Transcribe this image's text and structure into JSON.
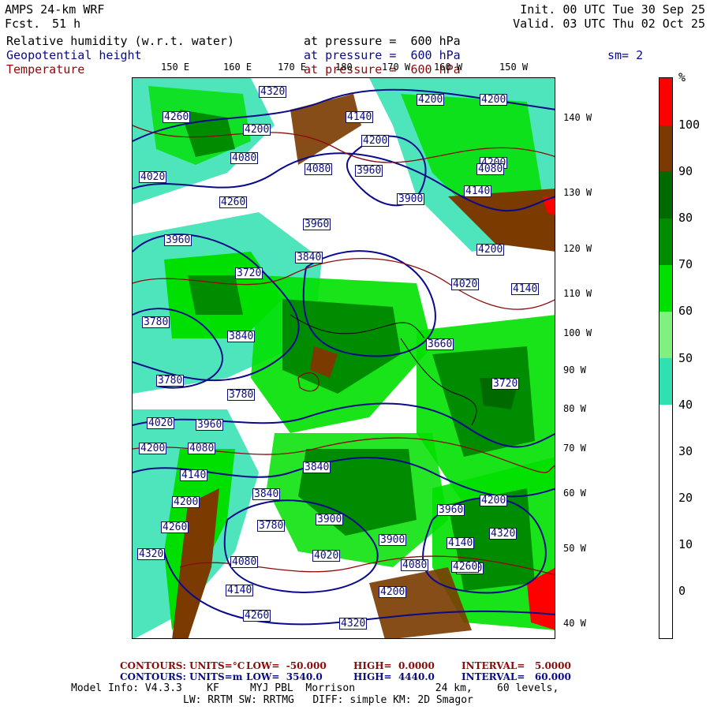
{
  "header": {
    "model": "AMPS 24-km WRF",
    "fcst_label": "Fcst.",
    "fcst_hours": "51 h",
    "init": "Init. 00 UTC Tue 30 Sep 25",
    "valid": "Valid. 03 UTC Thu 02 Oct 25"
  },
  "fields": [
    {
      "name": "Relative humidity (w.r.t. water)",
      "level": "at pressure =  600 hPa",
      "color": "#000000"
    },
    {
      "name": "Geopotential height",
      "level": "at pressure =  600 hPa",
      "color": "#0a0a8a"
    },
    {
      "name": "Temperature",
      "level": "at pressure =  600 hPa",
      "color": "#8a0a0a"
    }
  ],
  "smoothing": "sm= 2",
  "lon_labels": [
    "150 E",
    "160 E",
    "170 E",
    "180",
    "170 W",
    "160 W",
    "150 W"
  ],
  "lat_labels": [
    "140 W",
    "130 W",
    "120 W",
    "110 W",
    "100 W",
    "90 W",
    "80 W",
    "70 W",
    "60 W",
    "50 W",
    "40 W"
  ],
  "height_labels": [
    "4320",
    "4200",
    "4260",
    "4200",
    "4140",
    "4200",
    "4200",
    "4080",
    "4080",
    "3960",
    "4020",
    "4140",
    "3900",
    "3960",
    "3960",
    "3840",
    "3780",
    "3720",
    "3840",
    "3660",
    "3780",
    "3780",
    "3720",
    "4020",
    "3960",
    "4080",
    "4200",
    "4140",
    "4200",
    "4260",
    "4320",
    "4080",
    "3900",
    "3840",
    "3900",
    "3780",
    "3840",
    "4020",
    "4080",
    "4200",
    "4260",
    "3960",
    "4140",
    "4140",
    "4260",
    "4200",
    "4320",
    "4320",
    "4200",
    "4260",
    "4080",
    "4140",
    "4020",
    "4200",
    "4260"
  ],
  "colorbar": {
    "unit": "%",
    "labels": [
      "100",
      "90",
      "80",
      "70",
      "60",
      "50",
      "40",
      "30",
      "20",
      "10",
      "0"
    ],
    "colors": [
      "#ff0000",
      "#7a3a00",
      "#006a00",
      "#008c00",
      "#00e000",
      "#80f080",
      "#30e0b0",
      "#ffffff",
      "#ffffff",
      "#ffffff",
      "#ffffff"
    ]
  },
  "contour_temp": {
    "label": "CONTOURS:",
    "units": "UNITS=°C",
    "low": "LOW=  -50.000",
    "high": "HIGH=  0.0000",
    "interval": "INTERVAL=   5.0000"
  },
  "contour_height": {
    "label": "CONTOURS:",
    "units": "UNITS=m",
    "low": "LOW=  3540.0",
    "high": "HIGH=  4440.0",
    "interval": "INTERVAL=   60.000"
  },
  "model_info_1": "Model Info: V4.3.3    KF     MYJ PBL  Morrison             24 km,    60 levels,",
  "model_info_2": "LW: RRTM SW: RRTMG   DIFF: simple KM: 2D Smagor"
}
